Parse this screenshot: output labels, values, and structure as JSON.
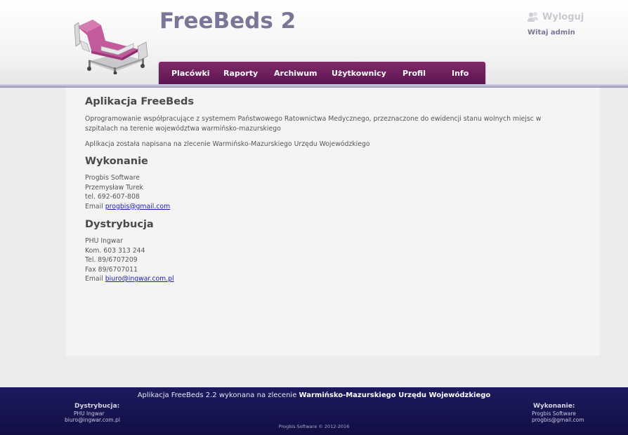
{
  "header": {
    "title": "FreeBeds 2",
    "logout_label": "Wyloguj",
    "greeting": "Witaj admin"
  },
  "nav": {
    "items": [
      "Placówki",
      "Raporty",
      "Archiwum",
      "Użytkownicy",
      "Profil",
      "Info"
    ]
  },
  "content": {
    "section1_title": "Aplikacja FreeBeds",
    "section1_para1": "Oprogramowanie współpracujące z systemem Państwowego Ratownictwa Medycznego, przeznaczone do ewidencji stanu wolnych miejsc w szpitalach na terenie województwa warmińsko-mazurskiego",
    "section1_para2": "Aplikacja została napisana na zlecenie Warmińsko-Mazurskiego Urzędu Wojewódzkiego",
    "section2_title": "Wykonanie",
    "wykonanie_lines": [
      "Progbis Software",
      "Przemysław Turek",
      "tel. 692-607-808"
    ],
    "wykonanie_email_label": "Email",
    "wykonanie_email": "progbis@gmail.com",
    "section3_title": "Dystrybucja",
    "dystrybucja_lines": [
      "PHU Ingwar",
      "Kom. 603 313 244",
      "Tel. 89/6707209",
      "Fax 89/6707011"
    ],
    "dystrybucja_email_label": "Email",
    "dystrybucja_email": "biuro@ingwar.com.pl"
  },
  "footer": {
    "main_prefix": "Aplikacja FreeBeds 2.2 wykonana na zlecenie",
    "main_bold": "Warmińsko-Mazurskiego Urzędu Wojewódzkiego",
    "left_title": "Dystrybucja:",
    "left_lines": [
      "PHU Ingwar",
      "biuro@ingwar.com.pl"
    ],
    "right_title": "Wykonanie:",
    "right_lines": [
      "Progbis Software",
      "progbis@gmail.com"
    ],
    "copyright": "Progbis Software © 2012-2016"
  },
  "colors": {
    "title": "#7b7597",
    "nav_bg": "#6e1e5e",
    "footer_bg": "#1a185a",
    "link": "#1a1ab4"
  },
  "icons": {
    "logo": "hospital-bed-icon",
    "logout": "users-logout-icon"
  }
}
